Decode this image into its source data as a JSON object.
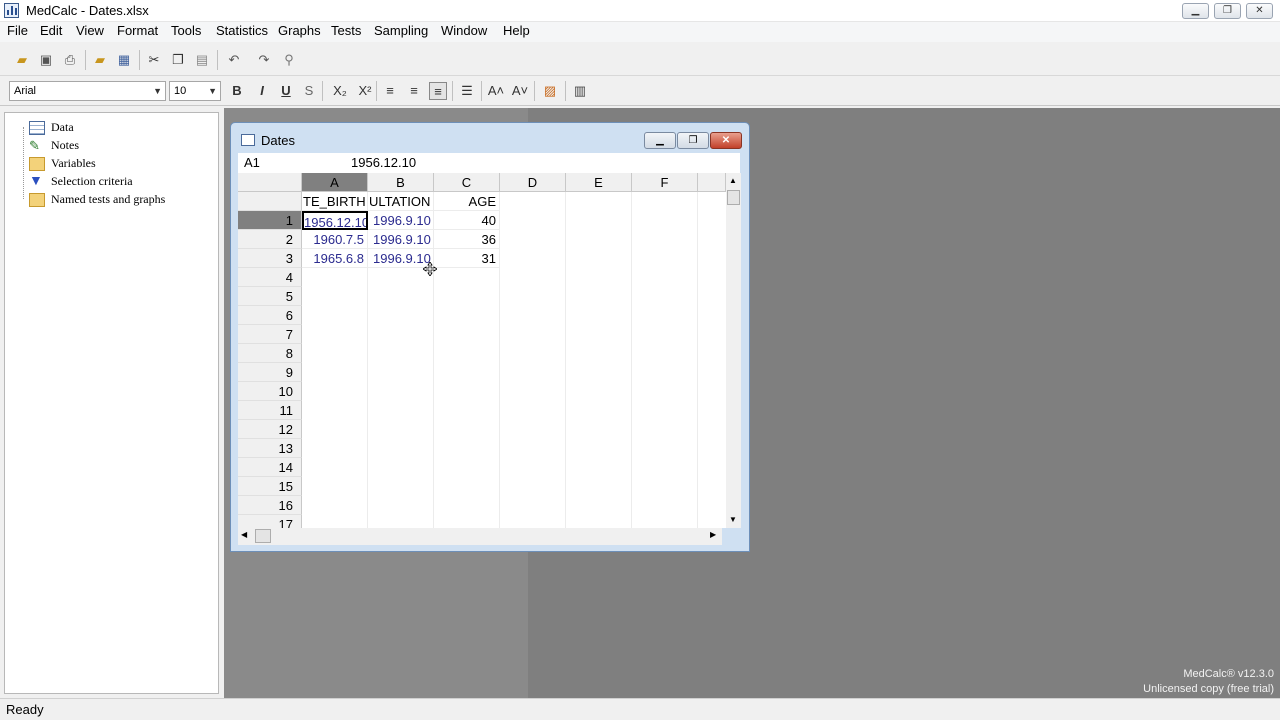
{
  "window": {
    "title": "MedCalc - Dates.xlsx"
  },
  "menu": [
    "File",
    "Edit",
    "View",
    "Format",
    "Tools",
    "Statistics",
    "Graphs",
    "Tests",
    "Sampling",
    "Window",
    "Help"
  ],
  "format_bar": {
    "font_name": "Arial",
    "font_size": "10",
    "bold": "B",
    "italic": "I",
    "underline": "U",
    "strike": "S",
    "subscript": "X₂",
    "superscript": "X²"
  },
  "navigator": {
    "items": [
      {
        "label": "Data",
        "icon": "data-sheet-icon"
      },
      {
        "label": "Notes",
        "icon": "notes-pencil-icon"
      },
      {
        "label": "Variables",
        "icon": "folder-icon"
      },
      {
        "label": "Selection criteria",
        "icon": "filter-funnel-icon"
      },
      {
        "label": "Named tests and graphs",
        "icon": "folder-icon"
      }
    ]
  },
  "sheet": {
    "title": "Dates",
    "cell_ref": "A1",
    "cell_value": "1956.12.10",
    "columns": [
      "A",
      "B",
      "C",
      "D",
      "E",
      "F"
    ],
    "header_row": [
      "TE_BIRTH",
      "ULTATION",
      "AGE"
    ],
    "rows": [
      {
        "num": "1",
        "a": "1956.12.10",
        "b": "1996.9.10",
        "c": "40"
      },
      {
        "num": "2",
        "a": "1960.7.5",
        "b": "1996.9.10",
        "c": "36"
      },
      {
        "num": "3",
        "a": "1965.6.8",
        "b": "1996.9.10",
        "c": "31"
      }
    ],
    "row_numbers": [
      "4",
      "5",
      "6",
      "7",
      "8",
      "9",
      "10",
      "11",
      "12",
      "13",
      "14",
      "15",
      "16",
      "17"
    ]
  },
  "status": {
    "text": "Ready"
  },
  "watermark": {
    "line1": "MedCalc® v12.3.0",
    "line2": "Unlicensed copy (free trial)"
  }
}
